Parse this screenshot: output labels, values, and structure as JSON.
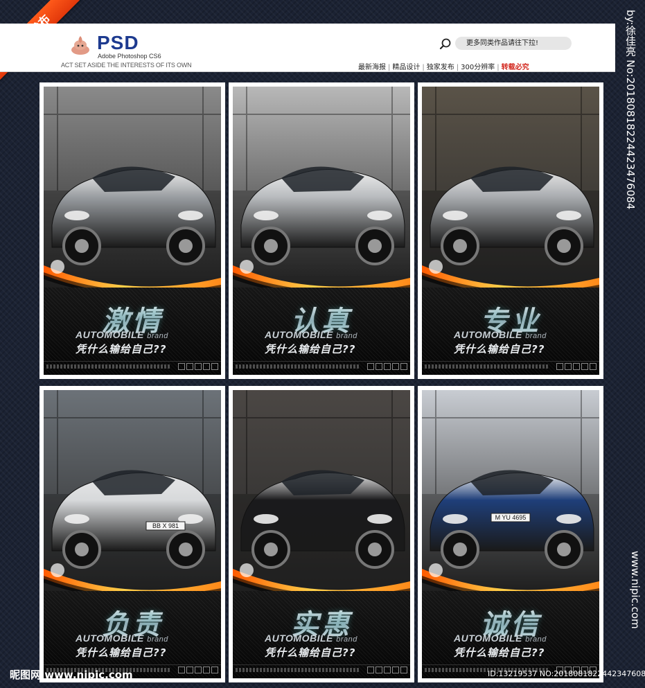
{
  "ribbon": {
    "text": "最新发布"
  },
  "header": {
    "psd_title": "PSD",
    "psd_sub": "Adobe Photoshop CS6",
    "tagline": "ACT SET ASIDE THE INTERESTS OF ITS OWN",
    "search_text": "更多同类作品请往下拉!",
    "nav": [
      "最新海报",
      "精品设计",
      "独家发布",
      "300分辨率"
    ],
    "nav_highlight": "转载必究"
  },
  "watermark": {
    "vertical": "by:徐佳亮 No:20180818224423476084",
    "site": "www.nipic.com",
    "bottom_logo": "昵图网 www.nipic.com",
    "bottom_id": "ID:13219537 NO:20180818224423476084"
  },
  "posters": [
    {
      "word": "激情",
      "brand": "AUTOMOBILE",
      "brand_small": "brand",
      "slogan": "凭什么输给自己??",
      "scene": "race",
      "sky": "#8a8a8a",
      "car": "#9a9ea2"
    },
    {
      "word": "认真",
      "brand": "AUTOMOBILE",
      "brand_small": "brand",
      "slogan": "凭什么输给自己??",
      "scene": "castle",
      "sky": "#b8b8b8",
      "car": "#b9bcbf"
    },
    {
      "word": "专业",
      "brand": "AUTOMOBILE",
      "brand_small": "brand",
      "slogan": "凭什么输给自己??",
      "scene": "garage",
      "sky": "#5a5348",
      "car": "#a9acb0"
    },
    {
      "word": "负责",
      "brand": "AUTOMOBILE",
      "brand_small": "brand",
      "slogan": "凭什么输给自己??",
      "scene": "city",
      "sky": "#6c7278",
      "car": "#d7d9db"
    },
    {
      "word": "实惠",
      "brand": "AUTOMOBILE",
      "brand_small": "brand",
      "slogan": "凭什么输给自己??",
      "scene": "factory",
      "sky": "#4b4744",
      "car": "#1a1a1c"
    },
    {
      "word": "诚信",
      "brand": "AUTOMOBILE",
      "brand_small": "brand",
      "slogan": "凭什么输给自己??",
      "scene": "road",
      "sky": "#c8ccd2",
      "car": "#1f3f7a"
    }
  ],
  "plates": [
    "BB X 981",
    "M YU 4695"
  ],
  "colors": {
    "accent_orange": "#ff8a1a",
    "nav_red": "#d3281f",
    "psd_blue": "#1d3a8f"
  }
}
